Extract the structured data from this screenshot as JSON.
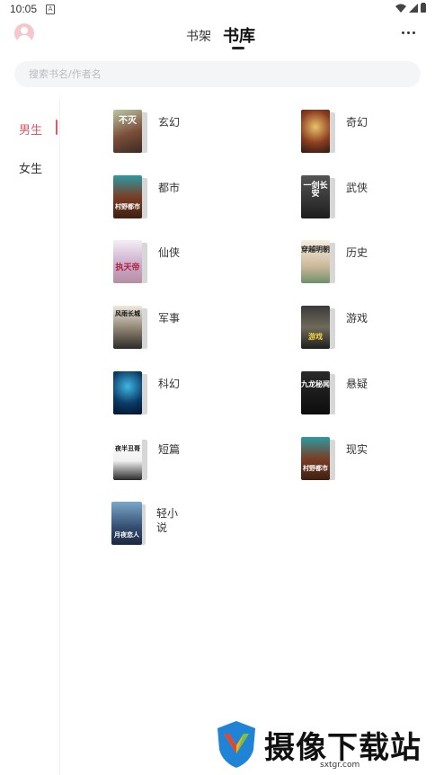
{
  "status": {
    "time": "10:05",
    "notification_icon": "a-icon"
  },
  "header": {
    "tabs": [
      {
        "label": "书架",
        "active": false
      },
      {
        "label": "书库",
        "active": true
      }
    ]
  },
  "search": {
    "placeholder": "搜索书名/作者名"
  },
  "genders": [
    {
      "label": "男生",
      "selected": true
    },
    {
      "label": "女生",
      "selected": false
    }
  ],
  "categories": [
    {
      "label": "玄幻",
      "cover_text": "不灭"
    },
    {
      "label": "奇幻",
      "cover_text": ""
    },
    {
      "label": "都市",
      "cover_text": "村野都市"
    },
    {
      "label": "武侠",
      "cover_text": "一剑长安"
    },
    {
      "label": "仙侠",
      "cover_text": "执天帝"
    },
    {
      "label": "历史",
      "cover_text": "穿越明朝"
    },
    {
      "label": "军事",
      "cover_text": "风雨长城"
    },
    {
      "label": "游戏",
      "cover_text": "游戏"
    },
    {
      "label": "科幻",
      "cover_text": ""
    },
    {
      "label": "悬疑",
      "cover_text": "九龙秘闻"
    },
    {
      "label": "短篇",
      "cover_text": "夜半丑哥"
    },
    {
      "label": "现实",
      "cover_text": "村野都市"
    },
    {
      "label": "轻小说",
      "cover_text": "月夜恋人"
    }
  ],
  "colors": {
    "accent": "#e05a66",
    "text": "#333333",
    "search_bg": "#f4f5f7"
  },
  "watermark": {
    "brand": "摄像下载站",
    "url": "sxtgr.com"
  }
}
